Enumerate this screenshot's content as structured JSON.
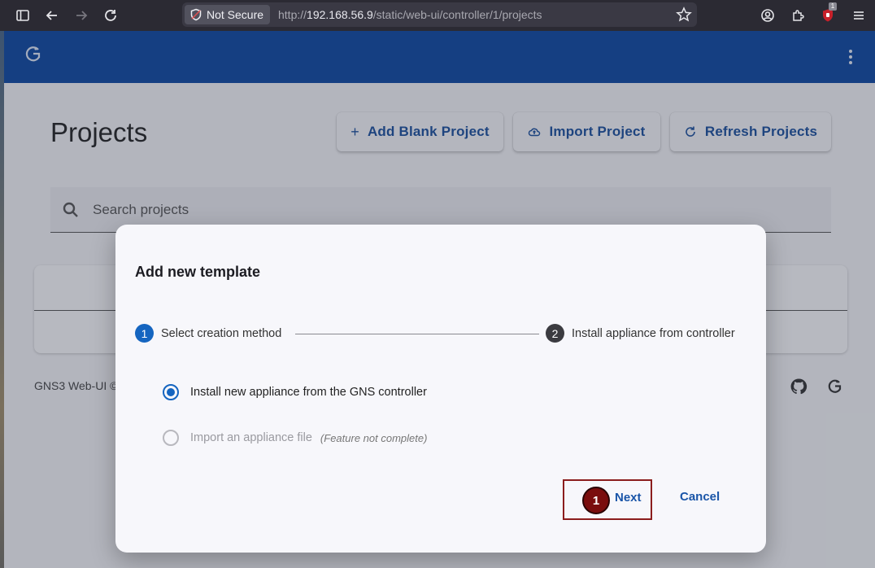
{
  "browser": {
    "security_label": "Not Secure",
    "url_prefix": "http://",
    "url_host": "192.168.56.9",
    "url_path": "/static/web-ui/controller/1/projects",
    "extension_badge": "1"
  },
  "page": {
    "title": "Projects",
    "buttons": {
      "add_blank": "Add Blank Project",
      "import": "Import Project",
      "refresh": "Refresh Projects"
    },
    "search_placeholder": "Search projects",
    "footer_text": "GNS3 Web-UI ©"
  },
  "dialog": {
    "title": "Add new template",
    "steps": [
      {
        "number": "1",
        "label": "Select creation method"
      },
      {
        "number": "2",
        "label": "Install appliance from controller"
      }
    ],
    "options": [
      {
        "label": "Install new appliance from the GNS controller",
        "selected": true
      },
      {
        "label": "Import an appliance file",
        "note": "(Feature not complete)",
        "disabled": true
      }
    ],
    "next_label": "Next",
    "cancel_label": "Cancel",
    "annotation_marker": "1"
  },
  "colors": {
    "topbar": "#0d47a1",
    "accent": "#1565c0",
    "highlight": "#8b1d1d"
  }
}
